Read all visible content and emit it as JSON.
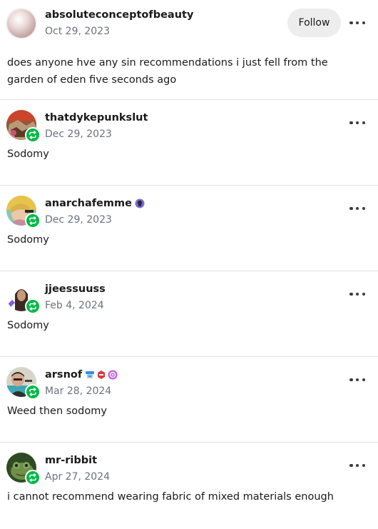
{
  "original_post": {
    "username": "absoluteconceptofbeauty",
    "date": "Oct 29, 2023",
    "follow_label": "Follow",
    "text": "does anyone hve any sin recommendations i just fell from the garden of eden five seconds ago"
  },
  "reblogs": [
    {
      "username": "thatdykepunkslut",
      "date": "Dec 29, 2023",
      "text": "Sodomy"
    },
    {
      "username": "anarchafemme",
      "date": "Dec 29, 2023",
      "text": "Sodomy"
    },
    {
      "username": "jjeessuuss",
      "date": "Feb 4, 2024",
      "text": "Sodomy"
    },
    {
      "username": "arsnof",
      "date": "Mar 28, 2024",
      "text": "Weed then sodomy"
    },
    {
      "username": "mr-ribbit",
      "date": "Apr 27, 2024",
      "text": "i cannot recommend wearing fabric of mixed materials enough"
    }
  ],
  "colors": {
    "reblog_badge": "#00b847",
    "follow_bg": "#ededed",
    "date_text": "#6b7280"
  },
  "icons": [
    "reblog-icon",
    "more-options-icon",
    "user-badge-icon"
  ]
}
